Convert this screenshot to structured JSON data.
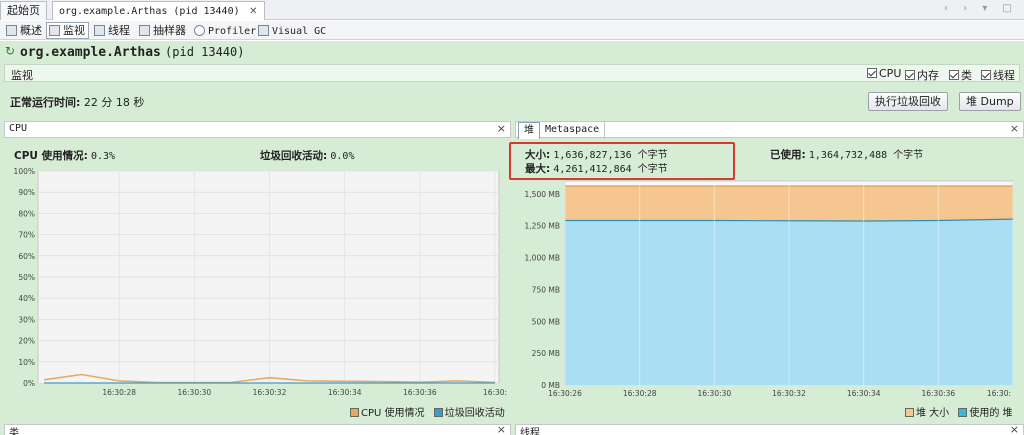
{
  "tabs": [
    {
      "label": "起始页"
    },
    {
      "label": "org.example.Arthas (pid 13440)"
    }
  ],
  "subtabs": [
    {
      "label": "概述"
    },
    {
      "label": "监视"
    },
    {
      "label": "线程"
    },
    {
      "label": "抽样器"
    },
    {
      "label": "Profiler"
    },
    {
      "label": "Visual GC"
    }
  ],
  "app": {
    "name": "org.example.Arthas",
    "pid": "(pid 13440)"
  },
  "monitor": {
    "label": "监视",
    "checks": [
      {
        "label": "CPU",
        "checked": true
      },
      {
        "label": "内存",
        "checked": true
      },
      {
        "label": "类",
        "checked": true
      },
      {
        "label": "线程",
        "checked": true
      }
    ]
  },
  "uptime": {
    "label": "正常运行时间:",
    "value": "22 分 18 秒"
  },
  "buttons": {
    "gc": "执行垃圾回收",
    "heap_dump": "堆 Dump"
  },
  "cpu_panel": {
    "title": "CPU",
    "close": "×",
    "usage_label": "CPU 使用情况:",
    "usage_value": "0.3%",
    "gc_label": "垃圾回收活动:",
    "gc_value": "0.0%",
    "legend_cpu": "CPU 使用情况",
    "legend_gc": "垃圾回收活动"
  },
  "heap_panel": {
    "tab_heap": "堆",
    "tab_meta": "Metaspace",
    "close": "×",
    "size_label": "大小:",
    "size_value": "1,636,827,136 个字节",
    "max_label": "最大:",
    "max_value": "4,261,412,864 个字节",
    "used_label": "已使用:",
    "used_value": "1,364,732,488 个字节",
    "legend_size": "堆 大小",
    "legend_used": "使用的 堆"
  },
  "bottom": {
    "left": "类",
    "right": "线程",
    "close": "×"
  },
  "colors": {
    "cpu": "#e8a95c",
    "gc": "#3f9cc8",
    "heap_size": "#f5c690",
    "heap_used": "#a9def5",
    "highlight": "#d43b2f"
  },
  "chart_data": [
    {
      "type": "line",
      "ylim": [
        0,
        100
      ],
      "yticks": [
        "0%",
        "10%",
        "20%",
        "30%",
        "40%",
        "50%",
        "60%",
        "70%",
        "80%",
        "90%",
        "100%"
      ],
      "xticks": [
        "16:30:28",
        "16:30:30",
        "16:30:32",
        "16:30:34",
        "16:30:36",
        "16:30:"
      ],
      "x": [
        "16:30:26",
        "16:30:27",
        "16:30:28",
        "16:30:29",
        "16:30:30",
        "16:30:31",
        "16:30:32",
        "16:30:33",
        "16:30:34",
        "16:30:35",
        "16:30:36",
        "16:30:37",
        "16:30:38"
      ],
      "series": [
        {
          "name": "CPU 使用情况",
          "values": [
            1.5,
            4.0,
            1.0,
            0.2,
            0.2,
            0.3,
            2.5,
            1.0,
            0.8,
            0.7,
            0.4,
            1.0,
            0.3
          ]
        },
        {
          "name": "垃圾回收活动",
          "values": [
            0,
            0,
            0,
            0,
            0,
            0,
            0,
            0,
            0,
            0,
            0,
            0,
            0
          ]
        }
      ]
    },
    {
      "type": "area",
      "ylim": [
        0,
        1600
      ],
      "yticks": [
        "0 MB",
        "250 MB",
        "500 MB",
        "750 MB",
        "1,000 MB",
        "1,250 MB",
        "1,500 MB"
      ],
      "xticks": [
        "16:30:26",
        "16:30:28",
        "16:30:30",
        "16:30:32",
        "16:30:34",
        "16:30:36",
        "16:30:"
      ],
      "x": [
        "16:30:26",
        "16:30:28",
        "16:30:30",
        "16:30:32",
        "16:30:34",
        "16:30:36",
        "16:30:38"
      ],
      "series": [
        {
          "name": "堆 大小",
          "values": [
            1561,
            1561,
            1561,
            1561,
            1561,
            1561,
            1561
          ]
        },
        {
          "name": "使用的 堆",
          "values": [
            1290,
            1290,
            1290,
            1288,
            1286,
            1290,
            1301
          ]
        }
      ]
    }
  ]
}
